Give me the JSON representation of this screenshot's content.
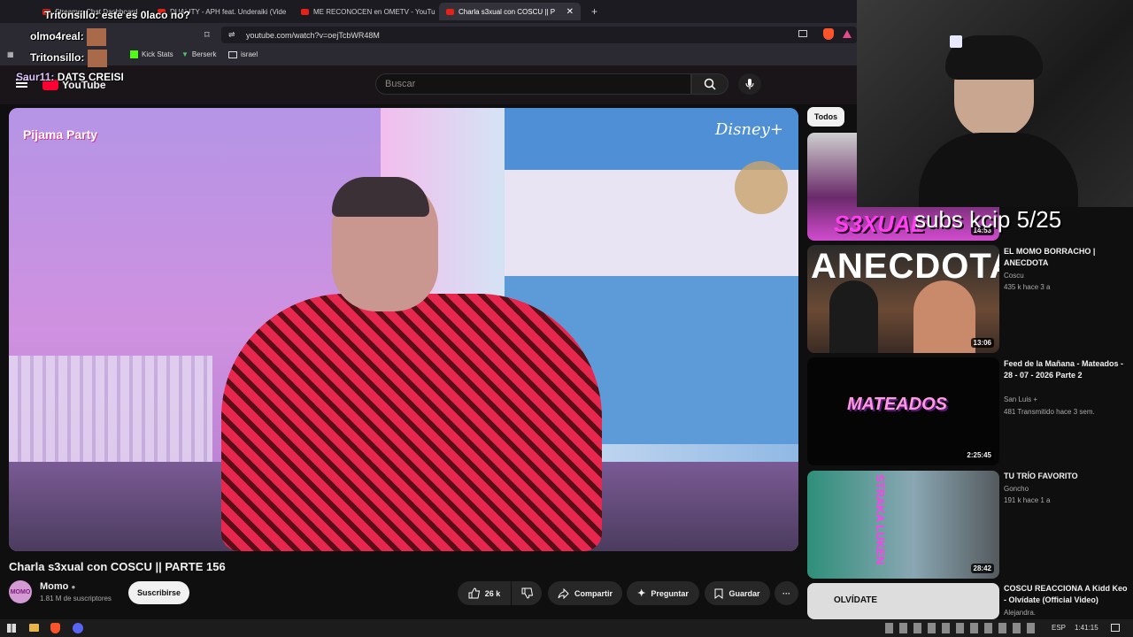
{
  "browser": {
    "tabs": [
      {
        "label": "Streamer Chat Dashboard",
        "active": false
      },
      {
        "label": "DUALITY - APH feat. Underaiki (Vide",
        "active": false
      },
      {
        "label": "ME RECONOCEN en OMETV - YouTu",
        "active": false
      },
      {
        "label": "Charla s3xual con COSCU || P",
        "active": true
      }
    ],
    "new_tab": "+",
    "url": "youtube.com/watch?v=oejTcbWR48M",
    "bookmarks": [
      "Kick Stats",
      "Berserk",
      "israel"
    ]
  },
  "youtube": {
    "logo": "YouTube",
    "search_placeholder": "Buscar",
    "video": {
      "title": "Charla s3xual con COSCU || PARTE 156",
      "overlay_logo_left": "Pijama Party",
      "overlay_logo_right": "Disney+",
      "channel": "Momo",
      "subscribers": "1.81 M de suscriptores",
      "subscribe_label": "Suscribirse",
      "likes": "26 k",
      "share_label": "Compartir",
      "ask_label": "Preguntar",
      "save_label": "Guardar",
      "more_label": "···"
    },
    "filter_chip": "Todos",
    "recommendations": [
      {
        "title": "",
        "channel": "",
        "meta": "",
        "duration": "14:53",
        "thumb_text": "S3XUAL"
      },
      {
        "title": "EL MOMO BORRACHO | ANECDOTA",
        "channel": "Coscu",
        "meta": "435 k   hace 3 a",
        "duration": "13:06",
        "thumb_text": "ANECDOTA"
      },
      {
        "title": "Feed de la Mañana - Mateados - 28 - 07 - 2026 Parte 2",
        "channel": "San Luis +",
        "meta": "481   Transmitido hace 3 sem.",
        "duration": "2:25:45",
        "thumb_text": "MATEADOS"
      },
      {
        "title": "TU TRÍO FAVORITO",
        "channel": "Goncho",
        "meta": "191 k   hace 1 a",
        "duration": "28:42",
        "thumb_text": "STRAKA LUKEN"
      },
      {
        "title": "COSCU REACCIONA A Kidd Keo - Olvídate (Official Video)",
        "channel": "Alejandra.",
        "meta": "",
        "duration": "",
        "thumb_text": "OLVÍDATE"
      }
    ]
  },
  "overlay": {
    "chat": [
      {
        "user": "Tritonsillo",
        "message": "este es 0laco no?"
      },
      {
        "user": "olmo4real",
        "message": ""
      },
      {
        "user": "Tritonsillo",
        "message": ""
      },
      {
        "user": "Saur11",
        "message": "DATS CREISI"
      }
    ],
    "subs_text": "subs kcip 5/25"
  },
  "taskbar": {
    "language": "ESP",
    "time": "1:41:15"
  },
  "colors": {
    "youtube_red": "#ff0033",
    "background": "#0f0f0f"
  }
}
